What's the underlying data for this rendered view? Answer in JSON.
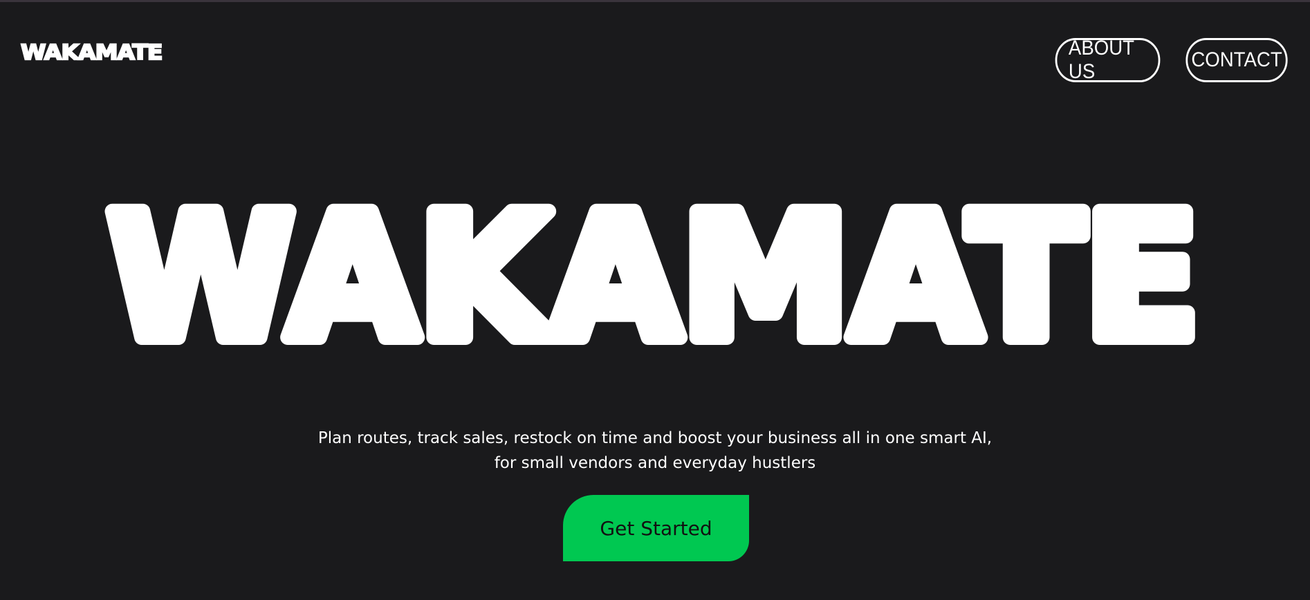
{
  "header": {
    "logo_text": "WAKAMATE",
    "nav": [
      {
        "label": "ABOUT US"
      },
      {
        "label": "CONTACT"
      }
    ]
  },
  "hero": {
    "title": "WAKAMATE",
    "tagline_line1": "Plan routes, track sales, restock on time and boost your business all in one smart AI,",
    "tagline_line2": "for small vendors and everyday hustlers",
    "cta_label": "Get Started"
  },
  "colors": {
    "background": "#1a1a1c",
    "text": "#ffffff",
    "accent": "#00c851",
    "cta_text": "#111111"
  }
}
